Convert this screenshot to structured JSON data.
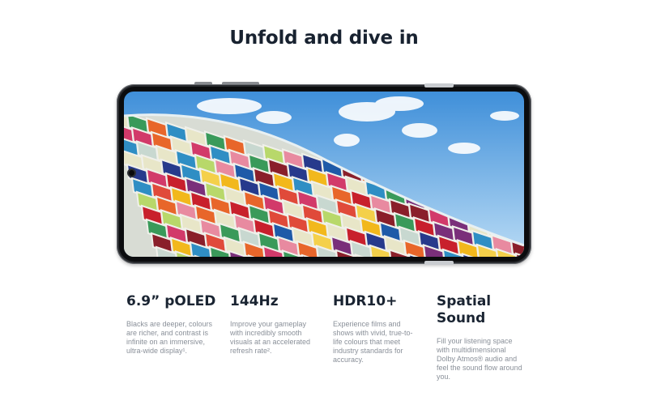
{
  "headline": "Unfold and dive in",
  "features": [
    {
      "title": "6.9” pOLED",
      "description": "Blacks are deeper, colours are richer, and contrast is infinite on an immersive, ultra-wide display¹."
    },
    {
      "title": "144Hz",
      "description": "Improve your gameplay with incredibly smooth visuals at an accelerated refresh rate²."
    },
    {
      "title": "HDR10+",
      "description": "Experience films and shows with vivid, true-to-life colours that meet industry standards for accuracy."
    },
    {
      "title": "Spatial Sound",
      "description": "Fill your listening space with multidimensional Dolby Atmos® audio and feel the sound flow around you."
    }
  ],
  "colors": {
    "sky_top": "#3f8fd9",
    "sky_bottom": "#b9dbf5",
    "frame": "#2a2c30",
    "heading": "#182230",
    "body_text": "#8a9099"
  },
  "icons": [
    "front-camera-icon"
  ]
}
